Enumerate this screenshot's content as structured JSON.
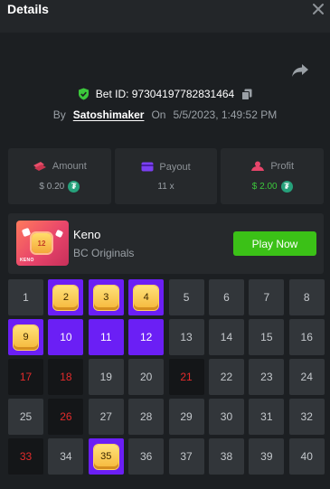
{
  "header": {
    "title": "Details"
  },
  "bet": {
    "id_label": "Bet ID: 97304197782831464",
    "by_label": "By",
    "user": "Satoshimaker",
    "on_label": "On",
    "datetime": "5/5/2023, 1:49:52 PM"
  },
  "stats": [
    {
      "label": "Amount",
      "value": "$ 0.20",
      "icon": "chips-icon",
      "currency_icon": "tether-icon"
    },
    {
      "label": "Payout",
      "value": "11 x",
      "icon": "wallet-icon"
    },
    {
      "label": "Profit",
      "value": "$ 2.00",
      "icon": "user-coin-icon",
      "currency_icon": "tether-icon"
    }
  ],
  "game": {
    "name": "Keno",
    "provider": "BC Originals",
    "play_label": "Play Now",
    "thumb_number": "12",
    "thumb_logo": "KENO"
  },
  "grid": {
    "cells": [
      {
        "n": "1",
        "s": "normal"
      },
      {
        "n": "2",
        "s": "hit"
      },
      {
        "n": "3",
        "s": "hit"
      },
      {
        "n": "4",
        "s": "hit"
      },
      {
        "n": "5",
        "s": "normal"
      },
      {
        "n": "6",
        "s": "normal"
      },
      {
        "n": "7",
        "s": "normal"
      },
      {
        "n": "8",
        "s": "normal"
      },
      {
        "n": "9",
        "s": "hit"
      },
      {
        "n": "10",
        "s": "sel"
      },
      {
        "n": "11",
        "s": "sel"
      },
      {
        "n": "12",
        "s": "sel"
      },
      {
        "n": "13",
        "s": "normal"
      },
      {
        "n": "14",
        "s": "normal"
      },
      {
        "n": "15",
        "s": "normal"
      },
      {
        "n": "16",
        "s": "normal"
      },
      {
        "n": "17",
        "s": "miss"
      },
      {
        "n": "18",
        "s": "miss"
      },
      {
        "n": "19",
        "s": "normal"
      },
      {
        "n": "20",
        "s": "normal"
      },
      {
        "n": "21",
        "s": "miss"
      },
      {
        "n": "22",
        "s": "normal"
      },
      {
        "n": "23",
        "s": "normal"
      },
      {
        "n": "24",
        "s": "normal"
      },
      {
        "n": "25",
        "s": "normal"
      },
      {
        "n": "26",
        "s": "miss"
      },
      {
        "n": "27",
        "s": "normal"
      },
      {
        "n": "28",
        "s": "normal"
      },
      {
        "n": "29",
        "s": "normal"
      },
      {
        "n": "30",
        "s": "normal"
      },
      {
        "n": "31",
        "s": "normal"
      },
      {
        "n": "32",
        "s": "normal"
      },
      {
        "n": "33",
        "s": "miss"
      },
      {
        "n": "34",
        "s": "normal"
      },
      {
        "n": "35",
        "s": "hit"
      },
      {
        "n": "36",
        "s": "normal"
      },
      {
        "n": "37",
        "s": "normal"
      },
      {
        "n": "38",
        "s": "normal"
      },
      {
        "n": "39",
        "s": "normal"
      },
      {
        "n": "40",
        "s": "normal"
      }
    ]
  },
  "colors": {
    "accent_purple": "#6b1ff5",
    "play_green": "#3bc117",
    "profit_green": "#3cc83c",
    "miss_red": "#e32b2b"
  }
}
